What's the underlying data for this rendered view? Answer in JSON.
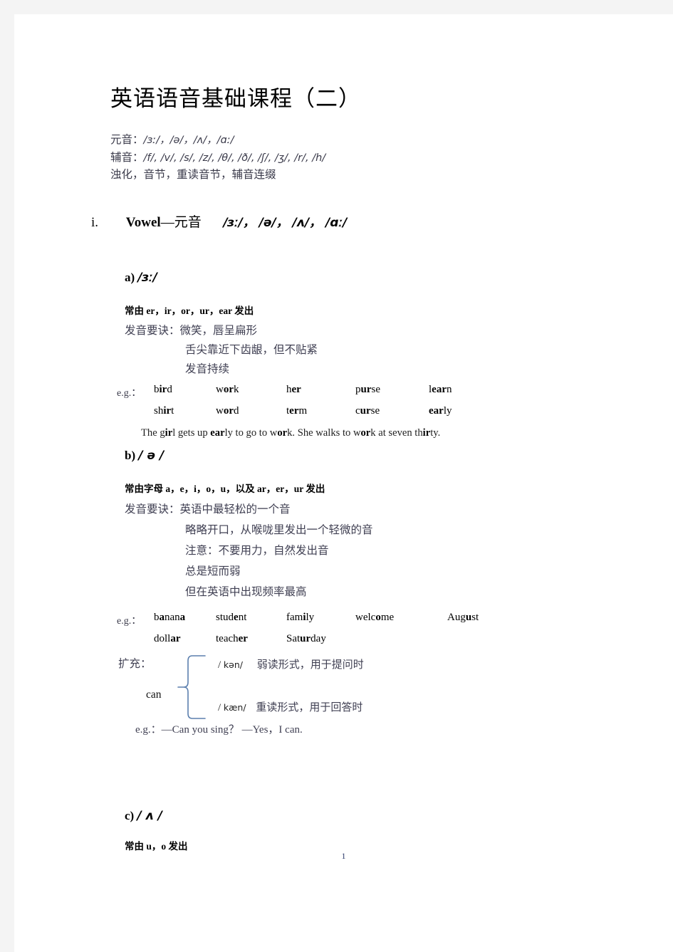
{
  "document": {
    "title": "英语语音基础课程（二）",
    "page_number": "1"
  },
  "summary": {
    "vowel_label": "元音：",
    "vowel_list": "/ɜː/，/ə/，/ʌ/，/ɑː/",
    "consonant_label": "辅音：",
    "consonant_list": "/f/, /v/, /s/, /z/, /θ/, /ð/, /ʃ/, /ʒ/, /r/, /h/",
    "topics": "浊化，音节，重读音节，辅音连缀"
  },
  "section": {
    "numeral": "i.",
    "title_en": "Vowel",
    "dash": "—",
    "title_cn": "元音",
    "ipa_list": "/ɜː/， /ə/， /ʌ/， /ɑː/"
  },
  "sub_a": {
    "marker": "a)",
    "ipa": "/ɜː/",
    "rule": "常由 er，ir，or，ur，ear 发出",
    "tip_label": "发音要诀：",
    "tips": [
      "微笑，唇呈扁形",
      "舌尖靠近下齿龈，但不贴紧",
      "发音持续"
    ],
    "eg_label": "e.g.：",
    "words_row1": [
      {
        "pre": "b",
        "mid": "ir",
        "post": "d"
      },
      {
        "pre": "w",
        "mid": "or",
        "post": "k"
      },
      {
        "pre": "h",
        "mid": "er",
        "post": ""
      },
      {
        "pre": "p",
        "mid": "ur",
        "post": "se"
      },
      {
        "pre": "l",
        "mid": "ear",
        "post": "n"
      }
    ],
    "words_row2": [
      {
        "pre": "sh",
        "mid": "ir",
        "post": "t"
      },
      {
        "pre": "w",
        "mid": "or",
        "post": "d"
      },
      {
        "pre": "t",
        "mid": "er",
        "post": "m"
      },
      {
        "pre": "c",
        "mid": "ur",
        "post": "se"
      },
      {
        "pre": "",
        "mid": "ear",
        "post": "ly"
      }
    ],
    "sentence_parts": [
      {
        "t": "The g",
        "b": false
      },
      {
        "t": "ir",
        "b": true
      },
      {
        "t": "l gets up ",
        "b": false
      },
      {
        "t": "ear",
        "b": true
      },
      {
        "t": "ly to go to w",
        "b": false
      },
      {
        "t": "or",
        "b": true
      },
      {
        "t": "k. She walks to w",
        "b": false
      },
      {
        "t": "or",
        "b": true
      },
      {
        "t": "k at seven th",
        "b": false
      },
      {
        "t": "ir",
        "b": true
      },
      {
        "t": "ty.",
        "b": false
      }
    ]
  },
  "sub_b": {
    "marker": "b)",
    "ipa": "/ ə /",
    "rule": "常由字母 a，e，i，o，u，以及 ar，er，ur 发出",
    "tip_label": "发音要诀：",
    "tips": [
      "英语中最轻松的一个音",
      "略略开口，从喉咙里发出一个轻微的音",
      "注意：不要用力，自然发出音",
      "总是短而弱",
      "但在英语中出现频率最高"
    ],
    "eg_label": "e.g.：",
    "words_row1": [
      {
        "pre": "b",
        "mid": "a",
        "post": "nan",
        "post2": "a"
      },
      {
        "pre": "stud",
        "mid": "e",
        "post": "nt"
      },
      {
        "pre": "fam",
        "mid": "i",
        "post": "ly"
      },
      {
        "pre": "welc",
        "mid": "o",
        "post": "me"
      },
      {
        "pre": "Aug",
        "mid": "u",
        "post": "st"
      }
    ],
    "words_row2": [
      {
        "pre": "doll",
        "mid": "ar",
        "post": ""
      },
      {
        "pre": "teach",
        "mid": "er",
        "post": ""
      },
      {
        "pre": "Sat",
        "mid": "ur",
        "post": "day"
      }
    ],
    "extension_label": "扩充：",
    "can_word": "can",
    "weak": {
      "slash_open": "/",
      "ipa": "kən/",
      "desc": "弱读形式，用于提问时"
    },
    "strong": {
      "slash_open": "/",
      "ipa": "kæn/",
      "desc": "重读形式，用于回答时"
    },
    "dialog_label": "e.g.：",
    "dialog": "—Can you sing？   —Yes，I can."
  },
  "sub_c": {
    "marker": "c)",
    "ipa": "/ ʌ /",
    "rule": "常由 u，o 发出"
  },
  "colors": {
    "page_bg": "#ffffff",
    "margin_bg": "#f4f4f4",
    "body_text": "#3f3f52",
    "heading_text": "#000000",
    "page_num": "#2b3a6b"
  }
}
